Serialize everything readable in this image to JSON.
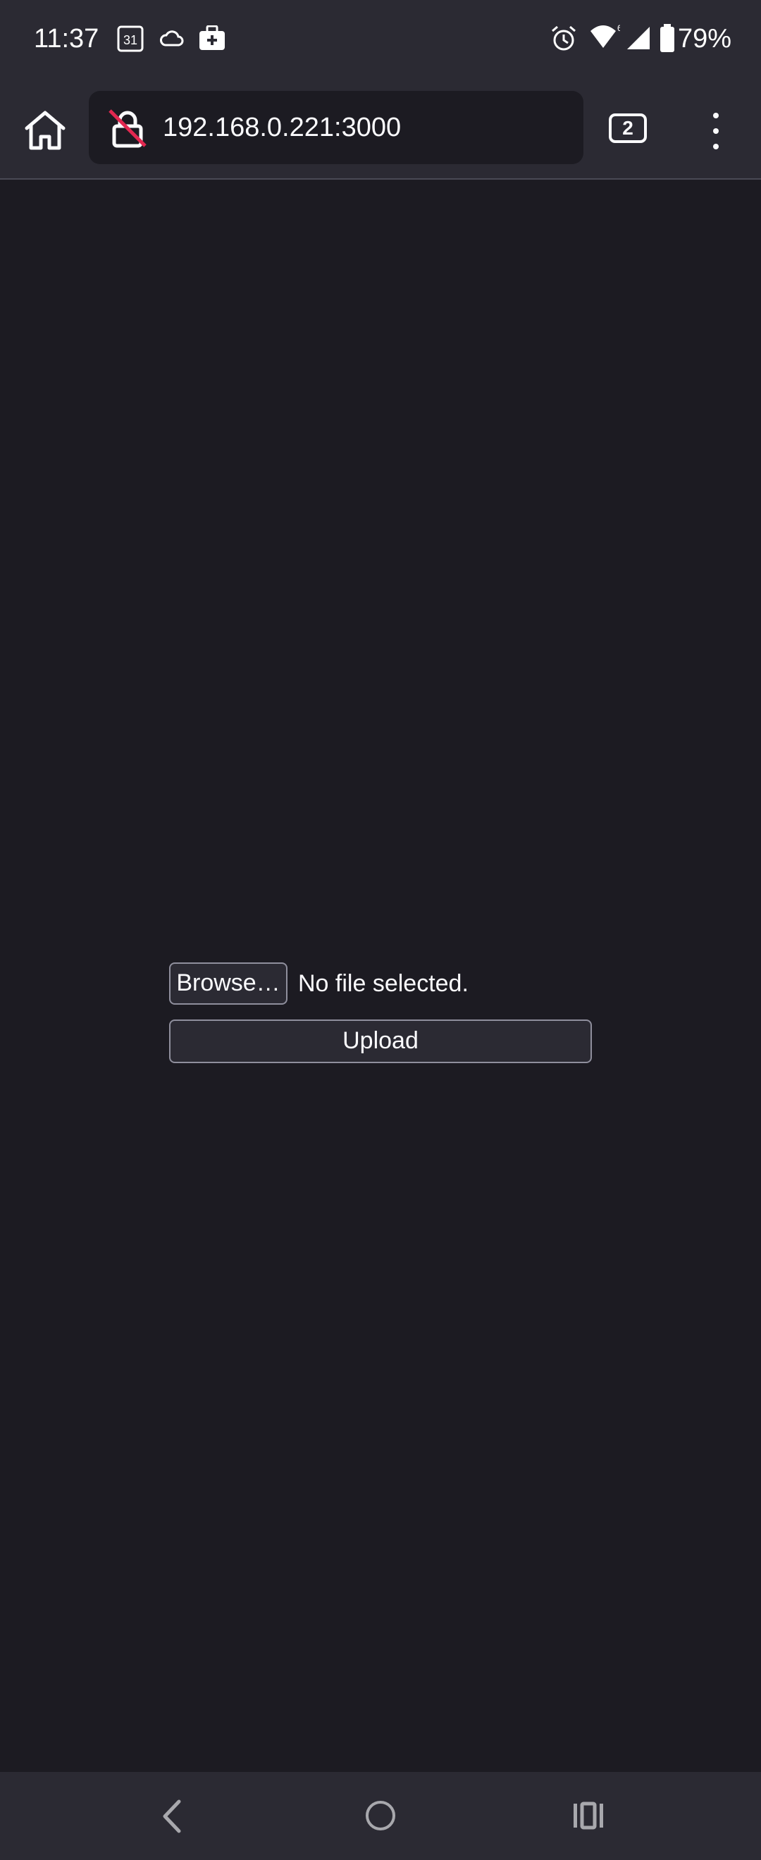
{
  "status_bar": {
    "time": "11:37",
    "calendar_day": "31",
    "battery": "79%",
    "icons": [
      "calendar-icon",
      "cloud-icon",
      "briefcase-icon",
      "alarm-icon",
      "wifi-icon",
      "signal-icon",
      "battery-icon"
    ]
  },
  "toolbar": {
    "url": "192.168.0.221:3000",
    "tab_count": "2",
    "icons": [
      "home-icon",
      "insecure-lock-icon",
      "menu-icon"
    ]
  },
  "form": {
    "browse_label": "Browse…",
    "file_status": "No file selected.",
    "upload_label": "Upload"
  },
  "nav_bar": {
    "icons": [
      "back-icon",
      "home-circle-icon",
      "recent-apps-icon"
    ]
  },
  "colors": {
    "background": "#1c1b22",
    "toolbar": "#2b2a33",
    "insecure_slash": "#e22850",
    "text": "#fbfbfe"
  }
}
